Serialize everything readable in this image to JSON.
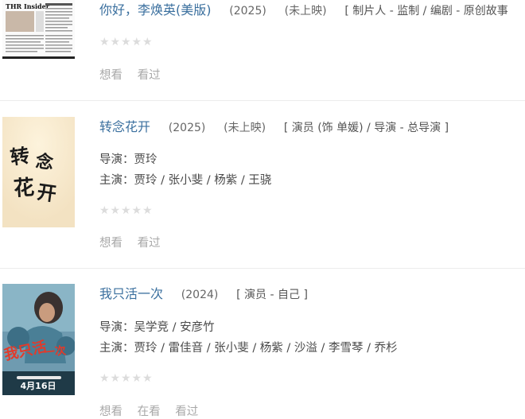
{
  "entries": [
    {
      "title": "你好，李焕英(美版)",
      "year": "(2025)",
      "status": "(未上映)",
      "role": "[ 制片人 - 监制 / 编剧 - 原创故事",
      "poster_text": "THR Insider",
      "actions": [
        "想看",
        "看过"
      ]
    },
    {
      "title": "转念花开",
      "year": "(2025)",
      "status": "(未上映)",
      "role": "[ 演员 (饰 单媛) / 导演 - 总导演 ]",
      "director": "导演：贾玲",
      "cast": "主演：贾玲 / 张小斐 / 杨紫 / 王骁",
      "poster_text": "转念花开",
      "actions": [
        "想看",
        "看过"
      ]
    },
    {
      "title": "我只活一次",
      "year": "(2024)",
      "role": "[ 演员 - 自己 ]",
      "director": "导演：吴学竞 / 安彦竹",
      "cast": "主演：贾玲 / 雷佳音 / 张小斐 / 杨紫 / 沙溢 / 李雪琴 / 乔杉",
      "poster_date": "4月16日",
      "actions": [
        "想看",
        "在看",
        "看过"
      ]
    }
  ],
  "rating_star": "★",
  "colors": {
    "title_link": "#3a6f9e",
    "muted": "#a8a8a8",
    "star": "#dcdcdc"
  }
}
